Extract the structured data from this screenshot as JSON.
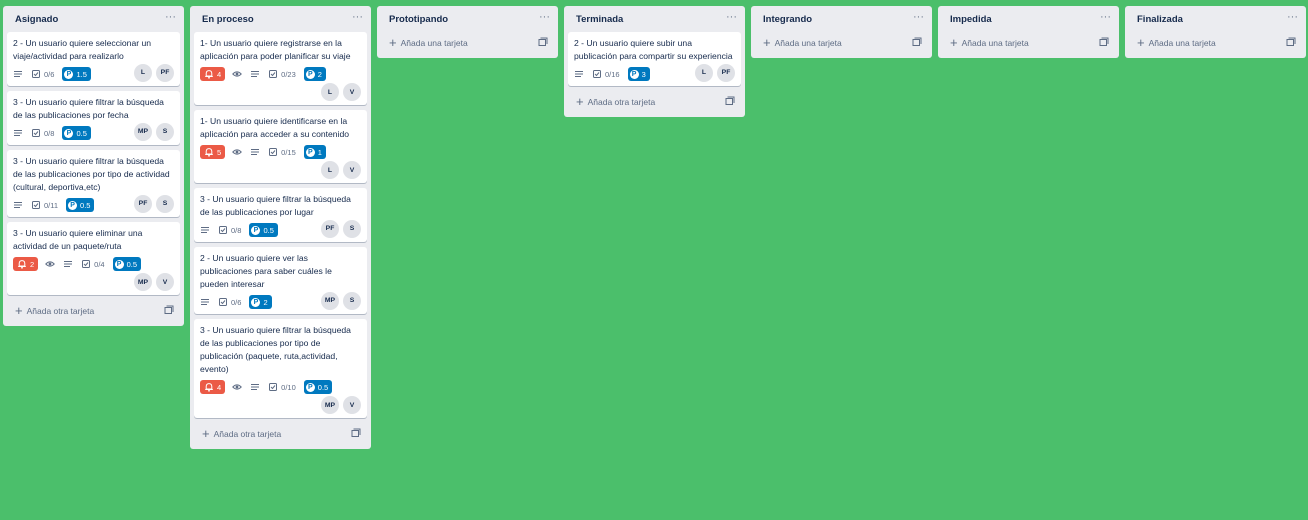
{
  "lists": [
    {
      "title": "Asignado",
      "footer": "Añada otra tarjeta",
      "cards": [
        {
          "title": "2 - Un usuario quiere seleccionar un viaje/actividad para realizarlo",
          "due": null,
          "watch": false,
          "desc": true,
          "checklist": "0/6",
          "points": "1.5",
          "members": [
            "L",
            "PF"
          ],
          "inline": true
        },
        {
          "title": "3 - Un usuario quiere filtrar la búsqueda de las publicaciones por fecha",
          "due": null,
          "watch": false,
          "desc": true,
          "checklist": "0/8",
          "points": "0.5",
          "members": [
            "MP",
            "S"
          ],
          "inline": true
        },
        {
          "title": "3 - Un usuario quiere filtrar la búsqueda de las publicaciones por tipo de actividad (cultural, deportiva,etc)",
          "due": null,
          "watch": false,
          "desc": true,
          "checklist": "0/11",
          "points": "0.5",
          "members": [
            "PF",
            "S"
          ],
          "inline": true
        },
        {
          "title": "3 - Un usuario quiere eliminar una actividad de un paquete/ruta",
          "due": "2",
          "watch": true,
          "desc": true,
          "checklist": "0/4",
          "points": "0.5",
          "members": [
            "MP",
            "V"
          ],
          "inline": false
        }
      ]
    },
    {
      "title": "En proceso",
      "footer": "Añada otra tarjeta",
      "cards": [
        {
          "title": "1- Un usuario quiere registrarse en la aplicación para poder planificar su viaje",
          "due": "4",
          "watch": true,
          "desc": true,
          "checklist": "0/23",
          "points": "2",
          "members": [
            "L",
            "V"
          ],
          "inline": false
        },
        {
          "title": "1- Un usuario quiere identificarse en la aplicación para acceder a su contenido",
          "due": "5",
          "watch": true,
          "desc": true,
          "checklist": "0/15",
          "points": "1",
          "members": [
            "L",
            "V"
          ],
          "inline": false
        },
        {
          "title": "3 - Un usuario quiere filtrar la búsqueda de las publicaciones por lugar",
          "due": null,
          "watch": false,
          "desc": true,
          "checklist": "0/8",
          "points": "0.5",
          "members": [
            "PF",
            "S"
          ],
          "inline": true
        },
        {
          "title": "2 - Un usuario quiere ver las publicaciones para saber cuáles le pueden interesar",
          "due": null,
          "watch": false,
          "desc": true,
          "checklist": "0/6",
          "points": "2",
          "members": [
            "MP",
            "S"
          ],
          "inline": true
        },
        {
          "title": "3 - Un usuario quiere filtrar la búsqueda de las publicaciones por tipo de publicación (paquete, ruta,actividad, evento)",
          "due": "4",
          "watch": true,
          "desc": true,
          "checklist": "0/10",
          "points": "0.5",
          "members": [
            "MP",
            "V"
          ],
          "inline": false
        }
      ]
    },
    {
      "title": "Prototipando",
      "footer": "Añada una tarjeta",
      "cards": []
    },
    {
      "title": "Terminada",
      "footer": "Añada otra tarjeta",
      "cards": [
        {
          "title": "2 - Un usuario quiere subir una publicación para compartir su experiencia",
          "due": null,
          "watch": false,
          "desc": true,
          "checklist": "0/16",
          "points": "3",
          "members": [
            "L",
            "PF"
          ],
          "inline": true
        }
      ]
    },
    {
      "title": "Integrando",
      "footer": "Añada una tarjeta",
      "cards": []
    },
    {
      "title": "Impedida",
      "footer": "Añada una tarjeta",
      "cards": []
    },
    {
      "title": "Finalizada",
      "footer": "Añada una tarjeta",
      "cards": []
    }
  ],
  "menu_glyph": "···",
  "points_glyph": "P",
  "colors": {
    "board": "#4bbf6b",
    "list": "#ebecf0",
    "due": "#eb5a46",
    "points": "#0079bf"
  },
  "icons": {
    "menu": "ellipsis-icon",
    "watch": "eye-icon",
    "description": "description-icon",
    "checklist": "checklist-icon",
    "due": "bell-icon",
    "add": "plus-icon",
    "template": "card-template-icon"
  }
}
